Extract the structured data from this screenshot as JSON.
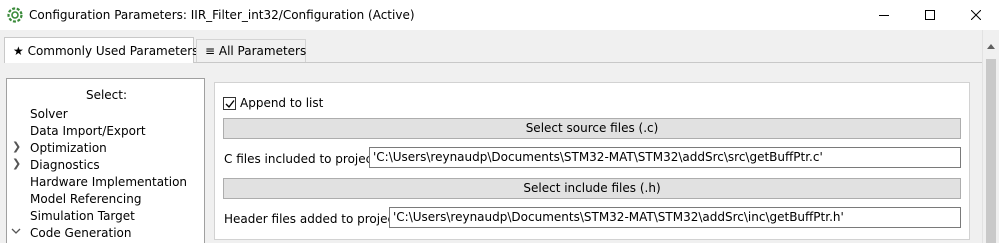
{
  "window": {
    "title": "Configuration Parameters: IIR_Filter_int32/Configuration (Active)",
    "icon": "simulink-gear-icon"
  },
  "tabs": [
    {
      "label": "★ Commonly Used Parameters",
      "active": true
    },
    {
      "label": "≡ All Parameters",
      "active": false
    }
  ],
  "tree": {
    "header": "Select:",
    "items": [
      {
        "label": "Solver",
        "expandable": false
      },
      {
        "label": "Data Import/Export",
        "expandable": false
      },
      {
        "label": "Optimization",
        "expandable": true
      },
      {
        "label": "Diagnostics",
        "expandable": true
      },
      {
        "label": "Hardware Implementation",
        "expandable": false
      },
      {
        "label": "Model Referencing",
        "expandable": false
      },
      {
        "label": "Simulation Target",
        "expandable": false
      },
      {
        "label": "Code Generation",
        "expandable": true,
        "expanded": true
      }
    ]
  },
  "content": {
    "append_checkbox": {
      "label": "Append to list",
      "checked": true
    },
    "select_source_button": "Select source files (.c)",
    "c_files_label": "C files included to project",
    "c_files_value": "'C:\\Users\\reynaudp\\Documents\\STM32-MAT\\STM32\\addSrc\\src\\getBuffPtr.c'",
    "select_include_button": "Select include files (.h)",
    "header_files_label": "Header files added to project",
    "header_files_value": "'C:\\Users\\reynaudp\\Documents\\STM32-MAT\\STM32\\addSrc\\inc\\getBuffPtr.h'"
  }
}
